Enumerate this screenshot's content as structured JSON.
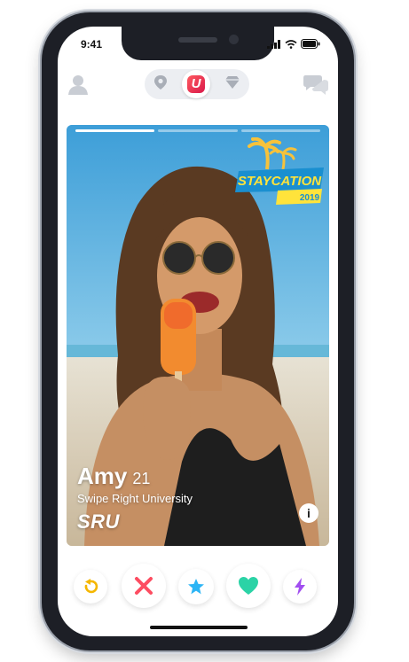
{
  "status_bar": {
    "time": "9:41"
  },
  "nav": {
    "icons": [
      "profile-icon",
      "location-pin-icon",
      "app-logo-icon",
      "diamond-icon",
      "chat-icon"
    ],
    "logo_letter": "U"
  },
  "card": {
    "photo_index": 1,
    "photo_count": 3,
    "badge": {
      "title": "STAYCATION",
      "year": "2019"
    },
    "name": "Amy",
    "age": "21",
    "school": "Swipe Right University",
    "school_short": "SRU",
    "info_label": "i"
  },
  "actions": [
    {
      "name": "rewind-button",
      "icon": "rewind-icon",
      "color": "#f5b700"
    },
    {
      "name": "nope-button",
      "icon": "close-icon",
      "color": "#fd4d61"
    },
    {
      "name": "super-like-button",
      "icon": "star-icon",
      "color": "#2db5f5"
    },
    {
      "name": "like-button",
      "icon": "heart-icon",
      "color": "#2bd3a6"
    },
    {
      "name": "boost-button",
      "icon": "lightning-icon",
      "color": "#a14ef0"
    }
  ],
  "colors": {
    "accent": "#fd3c63",
    "pill_bg": "#eceef2"
  }
}
